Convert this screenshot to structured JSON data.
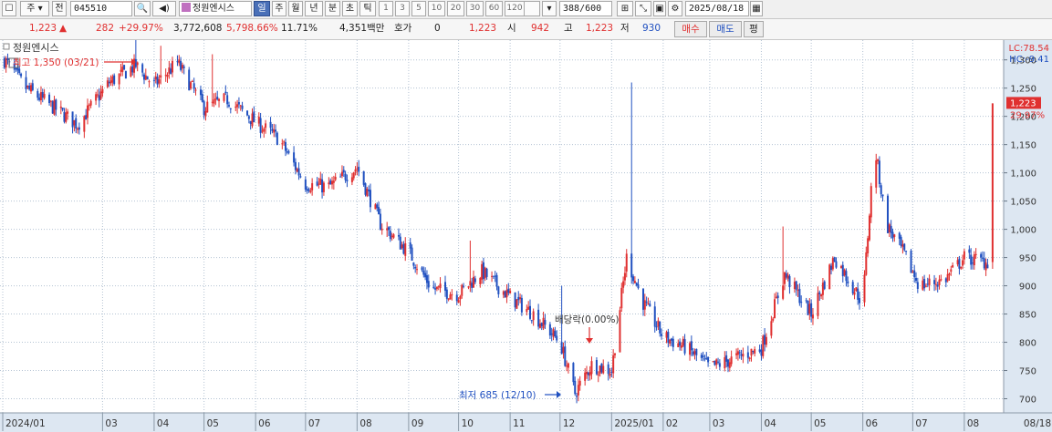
{
  "toolbar": {
    "type_label": "주",
    "jeon_label": "전",
    "code_value": "045510",
    "stock_name": "정원엔시스",
    "periods": [
      "일",
      "주",
      "월",
      "년",
      "분",
      "초",
      "틱"
    ],
    "intervals": [
      "1",
      "3",
      "5",
      "10",
      "20",
      "30",
      "60",
      "120"
    ],
    "count_value": "388",
    "count_max": "/600",
    "date_value": "2025/08/18"
  },
  "quote": {
    "price": "1,223",
    "change": "282",
    "change_pct": "+29.97%",
    "volume": "3,772,608",
    "volume_ratio": "5,798.66%",
    "turnover": "11.71%",
    "amount": "4,351백만",
    "hoga_label": "호가",
    "hoga_value": "0",
    "hoga_price": "1,223",
    "open_label": "시",
    "open_value": "942",
    "high_label": "고",
    "high_value": "1,223",
    "low_label": "저",
    "low_value": "930",
    "buy_label": "매수",
    "sell_label": "매도",
    "avg_label": "평"
  },
  "colors": {
    "up": "#e03030",
    "down": "#2050c0",
    "axis_bg": "#dde7f2",
    "grid": "#b4c3d3"
  },
  "chart_data": {
    "type": "candlestick",
    "title": "정원엔시스",
    "ylim": [
      675,
      1335
    ],
    "yticks": [
      700,
      750,
      800,
      850,
      900,
      950,
      1000,
      1050,
      1100,
      1150,
      1200,
      1250,
      1300
    ],
    "ytick_labels": [
      "700",
      "750",
      "800",
      "850",
      "900",
      "950",
      "1,000",
      "1,050",
      "1,100",
      "1,150",
      "1,200",
      "1,250",
      "1,300"
    ],
    "xticks": [
      "2024/01",
      "03",
      "04",
      "05",
      "06",
      "07",
      "08",
      "09",
      "10",
      "11",
      "12",
      "2025/01",
      "02",
      "03",
      "04",
      "05",
      "06",
      "07",
      "08",
      "08/18"
    ],
    "indicator_lc": "LC:78.54",
    "indicator_hc": "HC:-9.41",
    "last_price": 1223,
    "last_price_label": "1,223",
    "last_change_label": "29.97%",
    "annotations": {
      "high": {
        "label": "최고 1,350 (03/21)",
        "value": 1350
      },
      "low": {
        "label": "최저 685 (12/10)",
        "value": 685
      },
      "dividend": {
        "label": "배당락(0.00%)"
      }
    },
    "anchors": [
      [
        "2024-01-02",
        1300
      ],
      [
        "2024-01-15",
        1250
      ],
      [
        "2024-02-01",
        1215
      ],
      [
        "2024-02-15",
        1185
      ],
      [
        "2024-03-05",
        1260
      ],
      [
        "2024-03-21",
        1290
      ],
      [
        "2024-04-01",
        1255
      ],
      [
        "2024-04-15",
        1295
      ],
      [
        "2024-05-01",
        1215
      ],
      [
        "2024-05-15",
        1230
      ],
      [
        "2024-06-01",
        1190
      ],
      [
        "2024-06-15",
        1160
      ],
      [
        "2024-07-01",
        1080
      ],
      [
        "2024-07-15",
        1075
      ],
      [
        "2024-08-01",
        1110
      ],
      [
        "2024-08-15",
        1010
      ],
      [
        "2024-09-01",
        960
      ],
      [
        "2024-09-15",
        895
      ],
      [
        "2024-10-01",
        885
      ],
      [
        "2024-10-15",
        925
      ],
      [
        "2024-11-01",
        880
      ],
      [
        "2024-11-15",
        850
      ],
      [
        "2024-12-01",
        800
      ],
      [
        "2024-12-10",
        710
      ],
      [
        "2024-12-20",
        760
      ],
      [
        "2025-01-01",
        750
      ],
      [
        "2025-01-10",
        950
      ],
      [
        "2025-01-20",
        870
      ],
      [
        "2025-02-01",
        810
      ],
      [
        "2025-02-15",
        790
      ],
      [
        "2025-03-01",
        755
      ],
      [
        "2025-03-15",
        770
      ],
      [
        "2025-04-01",
        790
      ],
      [
        "2025-04-15",
        920
      ],
      [
        "2025-05-01",
        850
      ],
      [
        "2025-05-15",
        950
      ],
      [
        "2025-06-01",
        870
      ],
      [
        "2025-06-08",
        1150
      ],
      [
        "2025-06-15",
        1010
      ],
      [
        "2025-06-25",
        960
      ],
      [
        "2025-07-05",
        900
      ],
      [
        "2025-07-20",
        910
      ],
      [
        "2025-08-01",
        950
      ],
      [
        "2025-08-15",
        942
      ]
    ],
    "spikes": [
      [
        "2024-03-21",
        1350
      ],
      [
        "2024-04-05",
        1325
      ],
      [
        "2024-05-06",
        1310
      ],
      [
        "2024-10-08",
        980
      ],
      [
        "2024-12-02",
        900
      ],
      [
        "2025-01-13",
        1260
      ],
      [
        "2025-04-14",
        1005
      ],
      [
        "2025-06-08",
        1305
      ],
      [
        "2025-05-18",
        990
      ],
      [
        "2025-08-18",
        1223
      ]
    ],
    "last_candle": {
      "date": "2025-08-18",
      "open": 942,
      "high": 1223,
      "low": 930,
      "close": 1223
    }
  }
}
